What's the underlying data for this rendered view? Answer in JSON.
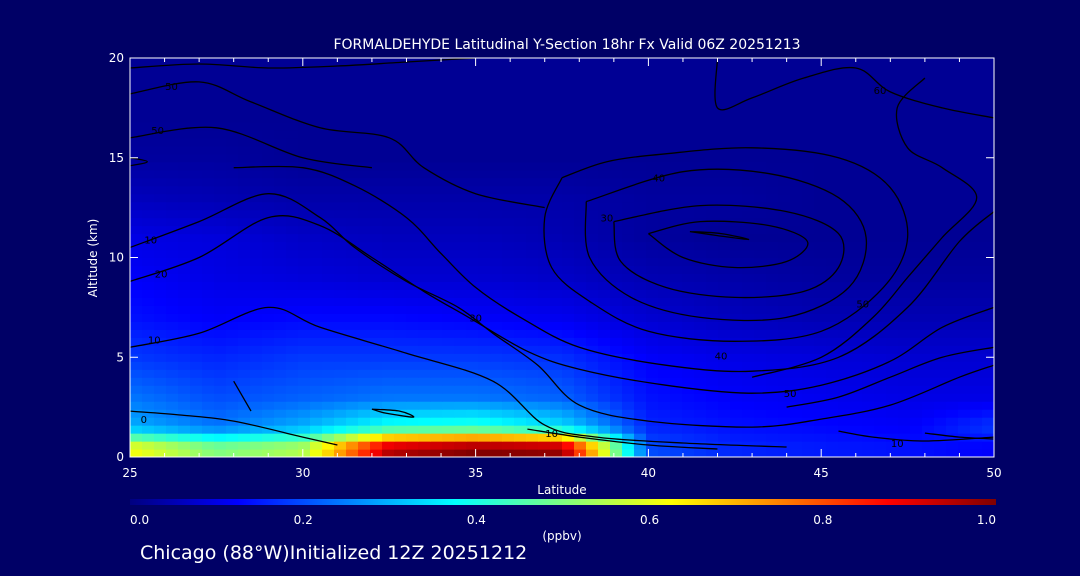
{
  "chart_data": {
    "type": "heatmap",
    "title": "FORMALDEHYDE Latitudinal Y-Section 18hr  Fx Valid 06Z 20251213",
    "xlabel": "Latitude",
    "ylabel": "Altitude (km)",
    "xlim": [
      25,
      50
    ],
    "ylim": [
      0,
      20
    ],
    "x_ticks": [
      "25",
      "30",
      "35",
      "40",
      "45",
      "50"
    ],
    "y_ticks": [
      "0",
      "5",
      "10",
      "15",
      "20"
    ],
    "colorbar": {
      "unit": "(ppbv)",
      "ticks": [
        "0.0",
        "0.2",
        "0.4",
        "0.6",
        "0.8",
        "1.0"
      ],
      "range": [
        0.0,
        1.0
      ],
      "colors": [
        "#000080",
        "#0000ff",
        "#0080ff",
        "#00ffff",
        "#80ff80",
        "#ffff00",
        "#ff8000",
        "#ff0000",
        "#800000"
      ]
    },
    "field_ppbv": {
      "latitude": [
        25,
        27.5,
        30,
        32.5,
        35,
        37.5,
        40,
        42.5,
        45,
        47.5,
        50
      ],
      "altitude_km": [
        0.5,
        1.5,
        3,
        5,
        7,
        9,
        11,
        13,
        15,
        17,
        19
      ],
      "values": [
        [
          0.62,
          0.5,
          0.55,
          0.95,
          1.0,
          0.98,
          0.2,
          0.16,
          0.15,
          0.14,
          0.12
        ],
        [
          0.3,
          0.24,
          0.3,
          0.4,
          0.42,
          0.35,
          0.16,
          0.14,
          0.13,
          0.12,
          0.18
        ],
        [
          0.24,
          0.2,
          0.22,
          0.24,
          0.24,
          0.22,
          0.14,
          0.12,
          0.11,
          0.1,
          0.1
        ],
        [
          0.18,
          0.16,
          0.18,
          0.18,
          0.18,
          0.17,
          0.12,
          0.1,
          0.09,
          0.08,
          0.08
        ],
        [
          0.14,
          0.12,
          0.13,
          0.13,
          0.12,
          0.11,
          0.08,
          0.06,
          0.05,
          0.05,
          0.05
        ],
        [
          0.12,
          0.1,
          0.09,
          0.08,
          0.08,
          0.07,
          0.05,
          0.04,
          0.03,
          0.03,
          0.03
        ],
        [
          0.1,
          0.09,
          0.07,
          0.06,
          0.06,
          0.05,
          0.03,
          0.02,
          0.02,
          0.02,
          0.02
        ],
        [
          0.06,
          0.05,
          0.04,
          0.04,
          0.04,
          0.04,
          0.03,
          0.03,
          0.02,
          0.02,
          0.02
        ],
        [
          0.03,
          0.03,
          0.02,
          0.02,
          0.02,
          0.02,
          0.02,
          0.02,
          0.02,
          0.02,
          0.02
        ],
        [
          0.02,
          0.02,
          0.02,
          0.02,
          0.02,
          0.02,
          0.02,
          0.02,
          0.02,
          0.02,
          0.02
        ],
        [
          0.02,
          0.02,
          0.02,
          0.02,
          0.02,
          0.02,
          0.02,
          0.02,
          0.02,
          0.02,
          0.02
        ]
      ]
    },
    "contours": [
      {
        "label": "0",
        "label_at": [
          25.4,
          1.9
        ],
        "path": [
          [
            25,
            2.3
          ],
          [
            26.5,
            2.1
          ],
          [
            28,
            1.8
          ],
          [
            30,
            1.0
          ],
          [
            31,
            0.6
          ]
        ]
      },
      {
        "label": "10",
        "label_at": [
          25.7,
          5.9
        ],
        "path": [
          [
            25,
            5.5
          ],
          [
            27,
            6.2
          ],
          [
            29,
            7.5
          ],
          [
            30.5,
            6.5
          ],
          [
            33,
            5.2
          ],
          [
            35.5,
            3.8
          ],
          [
            37,
            1.6
          ],
          [
            38.5,
            1.0
          ],
          [
            41,
            0.7
          ],
          [
            44,
            0.5
          ]
        ]
      },
      {
        "label": "10",
        "label_at": [
          37.2,
          1.2
        ],
        "path": [
          [
            36.5,
            1.4
          ],
          [
            38,
            1.0
          ],
          [
            40,
            0.6
          ],
          [
            42,
            0.4
          ]
        ]
      },
      {
        "label": "10",
        "label_at": [
          47.2,
          0.7
        ],
        "path": [
          [
            50,
            1.0
          ],
          [
            48,
            0.8
          ],
          [
            46.5,
            1.0
          ],
          [
            45.5,
            1.3
          ]
        ]
      },
      {
        "label": "10",
        "label_at": [
          25.6,
          10.9
        ],
        "path": [
          [
            25,
            10.5
          ],
          [
            27,
            11.8
          ],
          [
            29,
            13.2
          ],
          [
            30.5,
            12.0
          ],
          [
            31.5,
            10.5
          ],
          [
            33,
            8.8
          ],
          [
            34.5,
            7.5
          ],
          [
            35.5,
            6.2
          ],
          [
            36.8,
            4.6
          ],
          [
            38,
            2.6
          ],
          [
            40,
            1.8
          ],
          [
            43,
            1.5
          ],
          [
            45,
            1.9
          ],
          [
            47,
            2.6
          ],
          [
            49,
            4.0
          ],
          [
            50,
            4.6
          ]
        ]
      },
      {
        "label": "20",
        "label_at": [
          25.9,
          9.2
        ],
        "path": [
          [
            25,
            8.8
          ],
          [
            27,
            10.0
          ],
          [
            29,
            12.0
          ],
          [
            30.5,
            11.6
          ],
          [
            32,
            10.0
          ],
          [
            33.5,
            8.3
          ],
          [
            34.8,
            7.0
          ],
          [
            36.5,
            5.3
          ],
          [
            38,
            4.4
          ],
          [
            40.5,
            3.6
          ],
          [
            43,
            3.2
          ],
          [
            45,
            3.6
          ],
          [
            47,
            4.8
          ],
          [
            48.5,
            6.5
          ],
          [
            50,
            7.5
          ]
        ]
      },
      {
        "label": "30",
        "label_at": [
          35.0,
          7.0
        ],
        "path": [
          [
            28,
            14.5
          ],
          [
            30,
            14.5
          ],
          [
            31.5,
            13.6
          ],
          [
            33,
            12.0
          ],
          [
            34,
            10.2
          ],
          [
            35,
            8.5
          ],
          [
            36.3,
            7.0
          ],
          [
            38,
            5.5
          ],
          [
            40.5,
            4.6
          ],
          [
            43,
            4.3
          ],
          [
            45.5,
            5.0
          ],
          [
            47.5,
            7.5
          ],
          [
            49,
            10.8
          ],
          [
            50,
            12.3
          ]
        ]
      },
      {
        "label": "40",
        "label_at": [
          42.1,
          5.1
        ],
        "path": [
          [
            37.5,
            14.0
          ],
          [
            37.0,
            12.0
          ],
          [
            37.2,
            9.5
          ],
          [
            38.3,
            7.8
          ],
          [
            40,
            6.3
          ],
          [
            42.5,
            5.8
          ],
          [
            45,
            6.3
          ],
          [
            46.8,
            8.5
          ],
          [
            47.5,
            11.0
          ],
          [
            47.0,
            13.5
          ],
          [
            45.5,
            15.0
          ],
          [
            43,
            15.5
          ],
          [
            40.5,
            15.2
          ],
          [
            38.8,
            14.8
          ],
          [
            37.5,
            14.0
          ]
        ]
      },
      {
        "label": "40",
        "label_at": [
          40.3,
          14.0
        ],
        "path": [
          [
            38.2,
            12.8
          ],
          [
            38.3,
            10.0
          ],
          [
            39.5,
            8.0
          ],
          [
            41.5,
            7.0
          ],
          [
            44,
            7.0
          ],
          [
            45.8,
            8.5
          ],
          [
            46.3,
            11.0
          ],
          [
            45.5,
            13.0
          ],
          [
            43.5,
            14.2
          ],
          [
            41,
            14.3
          ],
          [
            38.2,
            12.8
          ]
        ]
      },
      {
        "label": "30",
        "label_at": [
          38.8,
          12.0
        ],
        "path": [
          [
            39.0,
            11.8
          ],
          [
            39.2,
            9.8
          ],
          [
            40.5,
            8.5
          ],
          [
            42.5,
            8.0
          ],
          [
            44.5,
            8.3
          ],
          [
            45.5,
            9.5
          ],
          [
            45.5,
            11.2
          ],
          [
            44,
            12.3
          ],
          [
            41.5,
            12.6
          ],
          [
            39.0,
            11.8
          ]
        ]
      },
      {
        "label": "",
        "label_at": [
          0,
          0
        ],
        "path": [
          [
            40.0,
            11.2
          ],
          [
            41.0,
            10.0
          ],
          [
            42.5,
            9.5
          ],
          [
            44.0,
            9.8
          ],
          [
            44.6,
            10.8
          ],
          [
            43.5,
            11.6
          ],
          [
            41.5,
            11.8
          ],
          [
            40.0,
            11.2
          ]
        ]
      },
      {
        "label": "",
        "label_at": [
          0,
          0
        ],
        "path": [
          [
            41.2,
            11.3
          ],
          [
            42.0,
            11.1
          ],
          [
            42.9,
            10.9
          ],
          [
            42.1,
            11.2
          ],
          [
            41.2,
            11.3
          ]
        ]
      },
      {
        "label": "50",
        "label_at": [
          26.2,
          18.6
        ],
        "path": [
          [
            25,
            18.2
          ],
          [
            27,
            18.8
          ],
          [
            28.5,
            17.8
          ],
          [
            30.5,
            16.5
          ],
          [
            32.5,
            16.0
          ],
          [
            33.5,
            14.5
          ],
          [
            35,
            13.2
          ],
          [
            37,
            12.5
          ]
        ]
      },
      {
        "label": "50",
        "label_at": [
          25.8,
          16.4
        ],
        "path": [
          [
            25,
            16.0
          ],
          [
            27.5,
            16.5
          ],
          [
            30,
            15.0
          ],
          [
            32,
            14.5
          ]
        ]
      },
      {
        "label": "50",
        "label_at": [
          46.2,
          7.7
        ],
        "path": [
          [
            48.0,
            19.0
          ],
          [
            47.2,
            17.5
          ],
          [
            47.5,
            15.5
          ],
          [
            48.5,
            14.5
          ],
          [
            49.5,
            13.0
          ],
          [
            48.5,
            11.0
          ],
          [
            47.5,
            9.0
          ],
          [
            46.5,
            7.0
          ],
          [
            45,
            5.0
          ],
          [
            43,
            4.0
          ]
        ]
      },
      {
        "label": "50",
        "label_at": [
          44.1,
          3.2
        ],
        "path": [
          [
            50,
            5.5
          ],
          [
            48.5,
            5.0
          ],
          [
            47.0,
            4.0
          ],
          [
            45.5,
            3.0
          ],
          [
            44.0,
            2.5
          ]
        ]
      },
      {
        "label": "60",
        "label_at": [
          46.7,
          18.4
        ],
        "path": [
          [
            42,
            20.0
          ],
          [
            42.0,
            17.5
          ],
          [
            43,
            18.0
          ],
          [
            44.5,
            19.0
          ],
          [
            46,
            19.5
          ],
          [
            47.0,
            18.3
          ],
          [
            48.5,
            17.5
          ],
          [
            50,
            17.0
          ]
        ]
      },
      {
        "label": "",
        "label_at": [
          0,
          0
        ],
        "path": [
          [
            25,
            19.5
          ],
          [
            27,
            19.7
          ],
          [
            29,
            19.5
          ],
          [
            31,
            19.6
          ],
          [
            33,
            19.8
          ],
          [
            35,
            20.0
          ]
        ]
      },
      {
        "label": "",
        "label_at": [
          0,
          0
        ],
        "path": [
          [
            25,
            15.0
          ],
          [
            25.5,
            14.8
          ],
          [
            25,
            14.6
          ]
        ]
      },
      {
        "label": "",
        "label_at": [
          0,
          0
        ],
        "path": [
          [
            32.0,
            2.4
          ],
          [
            32.8,
            2.3
          ],
          [
            33.2,
            2.0
          ],
          [
            32.4,
            2.2
          ],
          [
            32.0,
            2.4
          ]
        ]
      },
      {
        "label": "",
        "label_at": [
          0,
          0
        ],
        "path": [
          [
            48.0,
            1.2
          ],
          [
            49,
            1.0
          ],
          [
            50,
            0.9
          ]
        ]
      },
      {
        "label": "",
        "label_at": [
          0,
          0
        ],
        "path": [
          [
            28,
            3.8
          ],
          [
            28.5,
            2.3
          ]
        ]
      }
    ]
  },
  "footer": {
    "text": "Chicago (88°W)Initialized 12Z 20251212"
  }
}
